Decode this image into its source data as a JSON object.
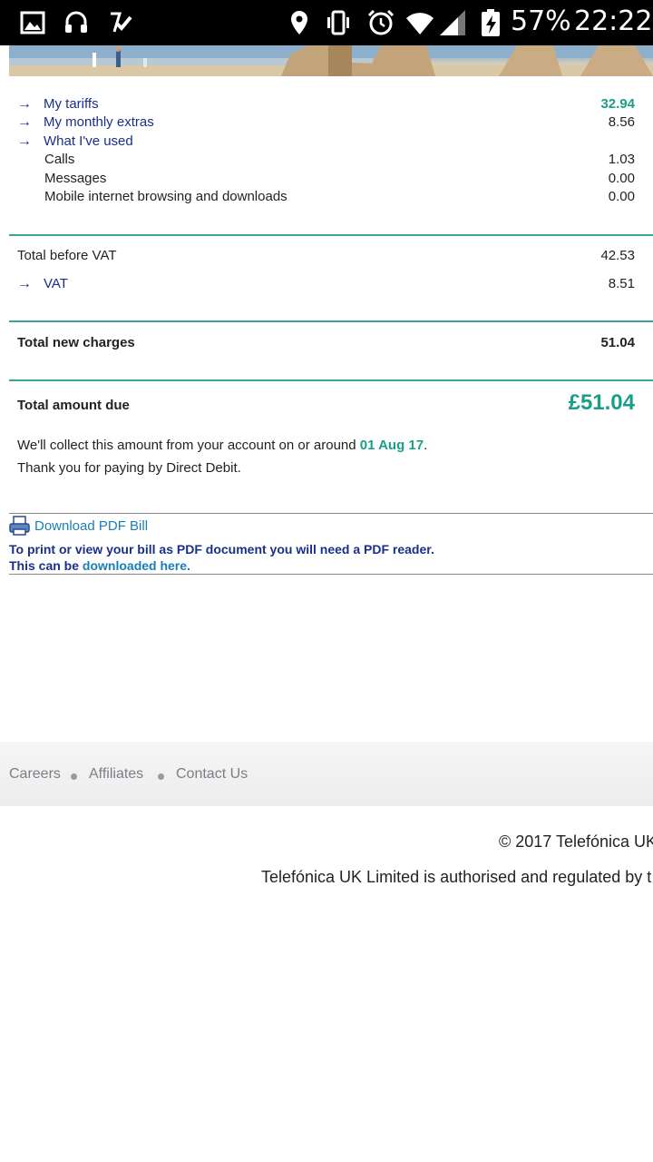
{
  "status_bar": {
    "battery": "57%",
    "time": "22:22",
    "icons": [
      "gallery-icon",
      "headset-icon",
      "task-check-icon",
      "location-icon",
      "vibrate-icon",
      "alarm-icon",
      "wifi-icon",
      "signal-icon",
      "battery-charging-icon"
    ]
  },
  "charges": {
    "my_tariffs": {
      "label": "My tariffs",
      "value": "32.94"
    },
    "monthly_extras": {
      "label": "My monthly extras",
      "value": "8.56"
    },
    "what_used": {
      "label": "What I've used"
    },
    "calls": {
      "label": "Calls",
      "value": "1.03"
    },
    "messages": {
      "label": "Messages",
      "value": "0.00"
    },
    "mobile_internet": {
      "label": "Mobile internet browsing and downloads",
      "value": "0.00"
    }
  },
  "totals": {
    "before_vat": {
      "label": "Total before VAT",
      "value": "42.53"
    },
    "vat": {
      "label": "VAT",
      "value": "8.51"
    },
    "new_charges": {
      "label": "Total new charges",
      "value": "51.04"
    },
    "amount_due": {
      "label": "Total amount due",
      "value": "£51.04"
    }
  },
  "payment_note": {
    "line1_prefix": "We'll collect this amount from your account on or around ",
    "date": "01 Aug 17",
    "line1_suffix": ".",
    "line2": "Thank you for paying by Direct Debit."
  },
  "pdf": {
    "link": "Download PDF Bill",
    "note_line1": "To print or view your bill as PDF document you will need a PDF reader.",
    "note_line2_prefix": "This can be ",
    "note_line2_link": "downloaded here."
  },
  "footer": {
    "links": [
      "Careers",
      "Affiliates",
      "Contact Us"
    ],
    "copyright": "© 2017 Telefónica UK",
    "regulated": "Telefónica UK Limited is authorised and regulated by t"
  },
  "colors": {
    "accent_teal": "#1a9e8a",
    "link_navy": "#1a2f8a",
    "link_blue": "#1a7fb6",
    "divider_teal": "#3aa596"
  }
}
